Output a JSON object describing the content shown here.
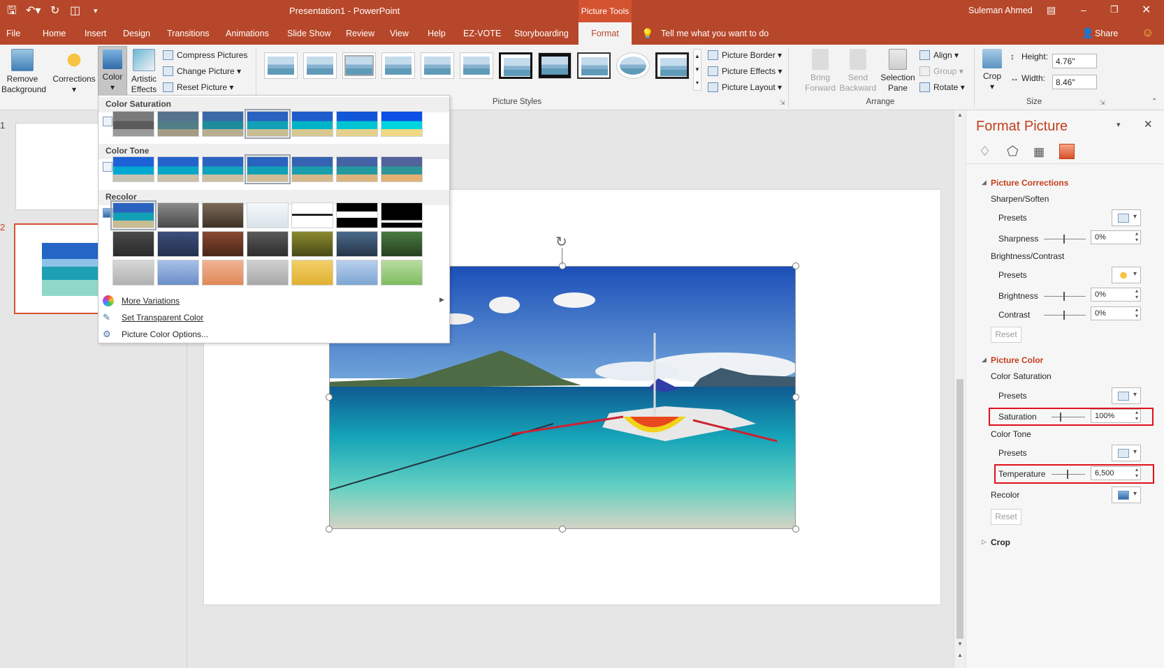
{
  "title_bar": {
    "doc_title": "Presentation1 - PowerPoint",
    "context_tab_group": "Picture Tools",
    "user": "Suleman Ahmed"
  },
  "tabs": [
    "File",
    "Home",
    "Insert",
    "Design",
    "Transitions",
    "Animations",
    "Slide Show",
    "Review",
    "View",
    "Help",
    "EZ-VOTE",
    "Storyboarding",
    "Format"
  ],
  "tell_me": "Tell me what you want to do",
  "share": "Share",
  "ribbon": {
    "remove_background": "Remove Background",
    "corrections": "Corrections",
    "color": "Color",
    "artistic_effects": "Artistic Effects",
    "compress_pictures": "Compress Pictures",
    "change_picture": "Change Picture",
    "reset_picture": "Reset Picture",
    "picture_styles_label": "Picture Styles",
    "picture_border": "Picture Border",
    "picture_effects": "Picture Effects",
    "picture_layout": "Picture Layout",
    "bring_forward": "Bring Forward",
    "send_backward": "Send Backward",
    "selection_pane": "Selection Pane",
    "align": "Align",
    "group": "Group",
    "rotate": "Rotate",
    "arrange_label": "Arrange",
    "crop": "Crop",
    "height_label": "Height:",
    "height_value": "4.76\"",
    "width_label": "Width:",
    "width_value": "8.46\"",
    "size_label": "Size"
  },
  "slides": {
    "thumb1": "1",
    "thumb2": "2"
  },
  "color_menu": {
    "saturation_header": "Color Saturation",
    "tone_header": "Color Tone",
    "recolor_header": "Recolor",
    "more_variations": "More Variations",
    "set_transparent": "Set Transparent Color",
    "color_options": "Picture Color Options..."
  },
  "format_pane": {
    "title": "Format Picture",
    "picture_corrections": "Picture Corrections",
    "sharpen_soften": "Sharpen/Soften",
    "presets": "Presets",
    "sharpness": "Sharpness",
    "sharpness_value": "0%",
    "brightness_contrast": "Brightness/Contrast",
    "brightness": "Brightness",
    "brightness_value": "0%",
    "contrast": "Contrast",
    "contrast_value": "0%",
    "reset": "Reset",
    "picture_color": "Picture Color",
    "color_saturation": "Color Saturation",
    "saturation": "Saturation",
    "saturation_value": "100%",
    "color_tone": "Color Tone",
    "temperature": "Temperature",
    "temperature_value": "6,500",
    "recolor": "Recolor",
    "crop": "Crop"
  },
  "colors": {
    "accent": "#b7472a",
    "highlight_box": "#e0101a"
  }
}
